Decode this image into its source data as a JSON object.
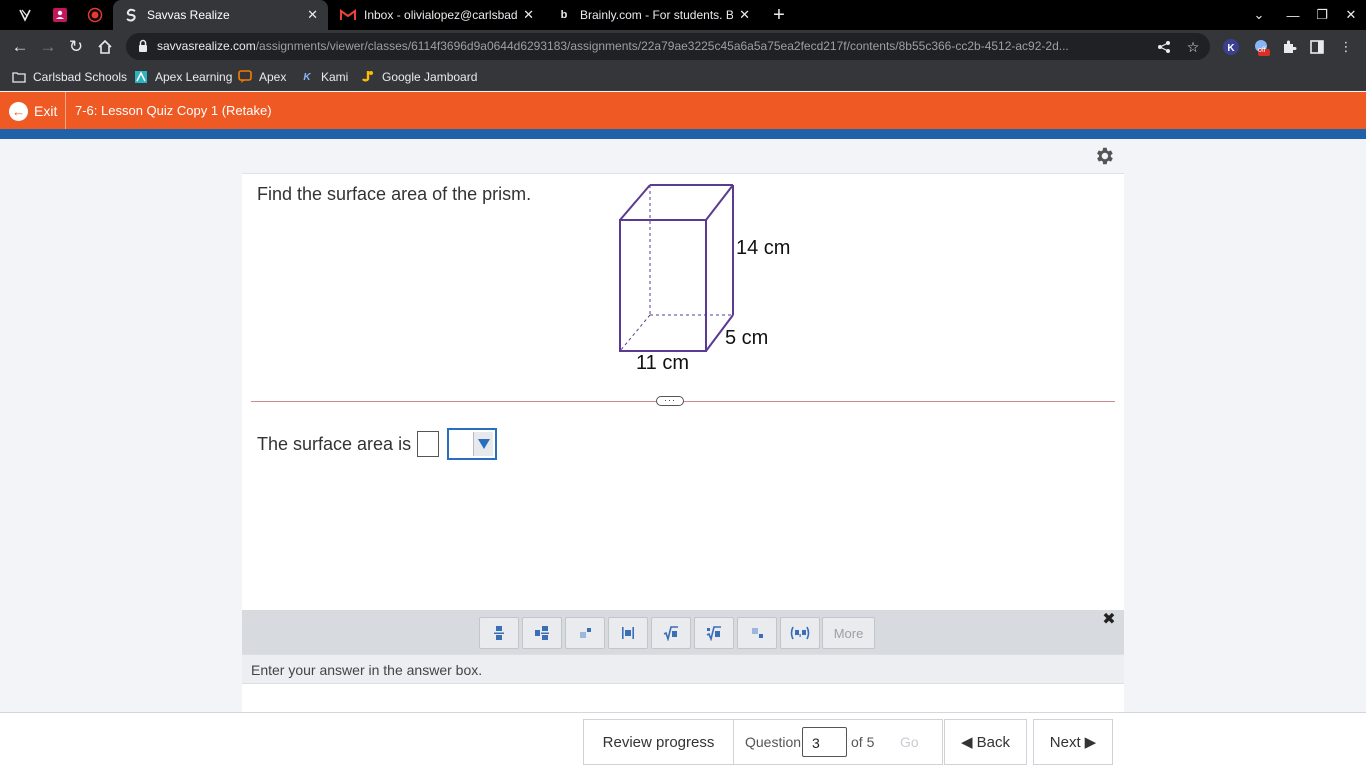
{
  "browser": {
    "tabs": [
      {
        "title": "Savvas Realize",
        "active": true
      },
      {
        "title": "Inbox - olivialopez@carlsbadsch",
        "active": false
      },
      {
        "title": "Brainly.com - For students. By st",
        "active": false
      }
    ],
    "url_host": "savvasrealize.com",
    "url_path": "/assignments/viewer/classes/6114f3696d9a0644d6293183/assignments/22a79ae3225c45a6a5a75ea2fecd217f/contents/8b55c366-cc2b-4512-ac92-2d...",
    "extension_badge": "off",
    "bookmarks": [
      {
        "label": "Carlsbad Schools",
        "icon": "folder-icon"
      },
      {
        "label": "Apex Learning",
        "icon": "apex-learning-icon"
      },
      {
        "label": "Apex",
        "icon": "apex-chat-icon"
      },
      {
        "label": "Kami",
        "icon": "kami-icon"
      },
      {
        "label": "Google Jamboard",
        "icon": "jamboard-icon"
      }
    ]
  },
  "app": {
    "exit_label": "Exit",
    "quiz_title": "7-6: Lesson Quiz Copy 1 (Retake)",
    "accent_color": "#ef5a24",
    "band_color": "#1f62a8"
  },
  "question": {
    "prompt": "Find the surface area of the prism.",
    "figure": {
      "height_label": "14 cm",
      "depth_label": "5 cm",
      "width_label": "11 cm"
    },
    "answer_label": "The surface area is",
    "answer_value": "",
    "unit_selected": ""
  },
  "palette": {
    "buttons": [
      "fraction",
      "mixed-number",
      "exponent",
      "absolute-value",
      "square-root",
      "nth-root",
      "subscript",
      "ordered-pair"
    ],
    "more_label": "More"
  },
  "hint": "Enter your answer in the answer box.",
  "footer": {
    "review_label": "Review progress",
    "question_label": "Question",
    "current_question": "3",
    "of_label": "of 5",
    "go_label": "Go",
    "back_label": "Back",
    "next_label": "Next"
  }
}
